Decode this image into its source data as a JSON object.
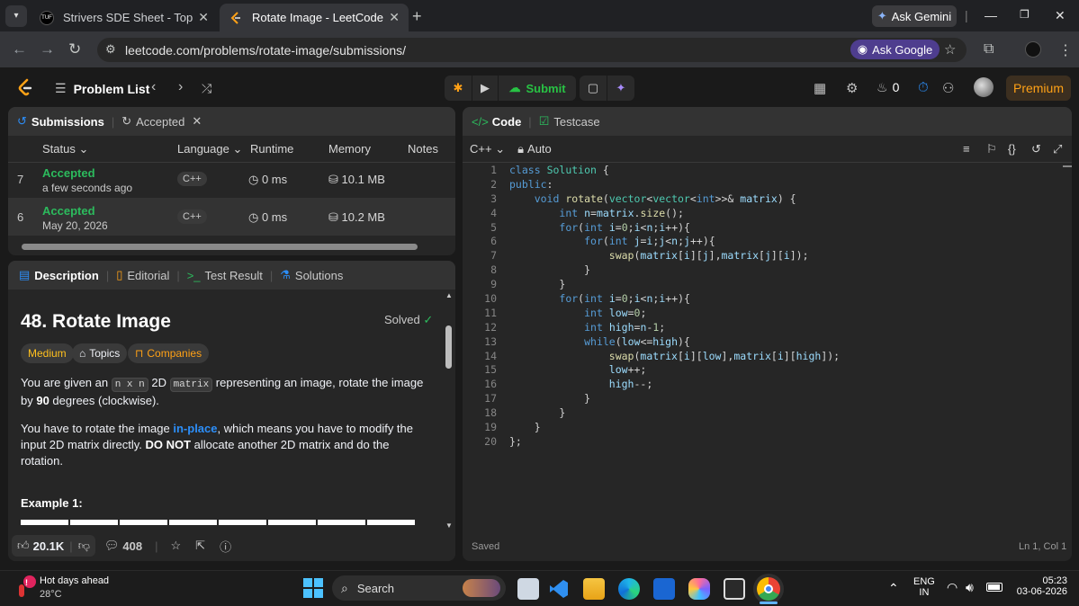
{
  "browser": {
    "tabs": [
      {
        "title": "Strivers SDE Sheet - Top Coding",
        "favicon": "tuf"
      },
      {
        "title": "Rotate Image - LeetCode",
        "favicon": "leetcode",
        "active": true
      }
    ],
    "ask_gemini": "Ask Gemini",
    "url": "leetcode.com/problems/rotate-image/submissions/",
    "ask_google": "Ask Google"
  },
  "header": {
    "problem_list": "Problem List",
    "submit": "Submit",
    "streak": "0",
    "premium": "Premium"
  },
  "submissions_panel": {
    "tab_submissions": "Submissions",
    "tab_accepted": "Accepted",
    "columns": [
      "Status",
      "Language",
      "Runtime",
      "Memory",
      "Notes"
    ],
    "rows": [
      {
        "num": "7",
        "status": "Accepted",
        "date": "a few seconds ago",
        "lang": "C++",
        "runtime": "0 ms",
        "memory": "10.1 MB"
      },
      {
        "num": "6",
        "status": "Accepted",
        "date": "May 20, 2026",
        "lang": "C++",
        "runtime": "0 ms",
        "memory": "10.2 MB"
      }
    ]
  },
  "description_panel": {
    "tabs": [
      "Description",
      "Editorial",
      "Test Result",
      "Solutions"
    ],
    "title": "48. Rotate Image",
    "solved": "Solved",
    "difficulty": "Medium",
    "topics": "Topics",
    "companies": "Companies",
    "p1_a": "You are given an ",
    "p1_code1": "n x n",
    "p1_b": " 2D ",
    "p1_code2": "matrix",
    "p1_c": " representing an image, rotate the image by ",
    "p1_d": "90",
    "p1_e": " degrees (clockwise).",
    "p2_a": "You have to rotate the image ",
    "p2_link": "in-place",
    "p2_b": ", which means you have to modify the input 2D matrix directly. ",
    "p2_bold": "DO NOT",
    "p2_c": " allocate another 2D matrix and do the rotation.",
    "example": "Example 1:",
    "likes": "20.1K",
    "comments": "408"
  },
  "code_panel": {
    "tab_code": "Code",
    "tab_testcase": "Testcase",
    "language": "C++",
    "auto": "Auto",
    "saved": "Saved",
    "cursor": "Ln 1, Col 1"
  },
  "code_lines": [
    "class Solution {",
    "public:",
    "    void rotate(vector<vector<int>>& matrix) {",
    "        int n=matrix.size();",
    "        for(int i=0;i<n;i++){",
    "            for(int j=i;j<n;j++){",
    "                swap(matrix[i][j],matrix[j][i]);",
    "            }",
    "        }",
    "        for(int i=0;i<n;i++){",
    "            int low=0;",
    "            int high=n-1;",
    "            while(low<=high){",
    "                swap(matrix[i][low],matrix[i][high]);",
    "                low++;",
    "                high--;",
    "            }",
    "        }",
    "    }",
    "};"
  ],
  "taskbar": {
    "weather_title": "Hot days ahead",
    "weather_temp": "28°C",
    "search": "Search",
    "lang1": "ENG",
    "lang2": "IN",
    "time": "05:23",
    "date": "03-06-2026"
  }
}
